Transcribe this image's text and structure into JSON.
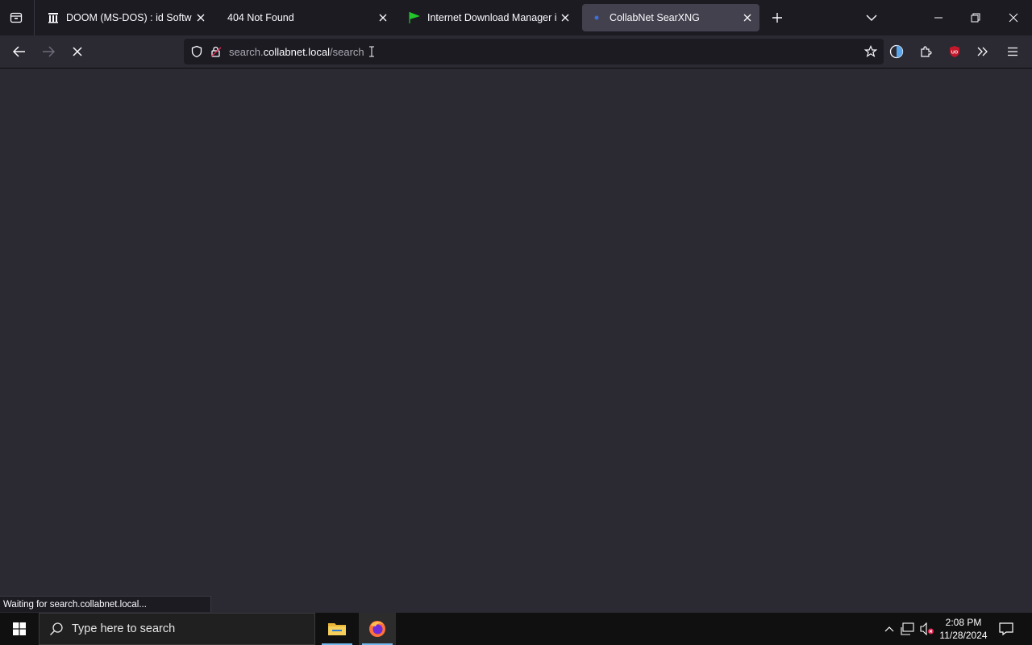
{
  "browser": {
    "tabs": [
      {
        "title": "DOOM (MS-DOS) : id Software",
        "active": false,
        "favicon": "archive-icon"
      },
      {
        "title": "404 Not Found",
        "active": false,
        "favicon": "none"
      },
      {
        "title": "Internet Download Manager is",
        "active": false,
        "favicon": "green-flag-icon"
      },
      {
        "title": "CollabNet SearXNG",
        "active": true,
        "favicon": "loading-dot-icon"
      }
    ],
    "url": {
      "scheme_prefix": "",
      "subdomain": "search.",
      "domain": "collabnet.local",
      "path": "/search"
    },
    "status_text": "Waiting for search.collabnet.local..."
  },
  "taskbar": {
    "search_placeholder": "Type here to search",
    "time": "2:08 PM",
    "date": "11/28/2024"
  },
  "colors": {
    "accent_ublock": "#c4182b",
    "idm_flag": "#22c62a",
    "firefox_underline": "#76b9ed"
  }
}
